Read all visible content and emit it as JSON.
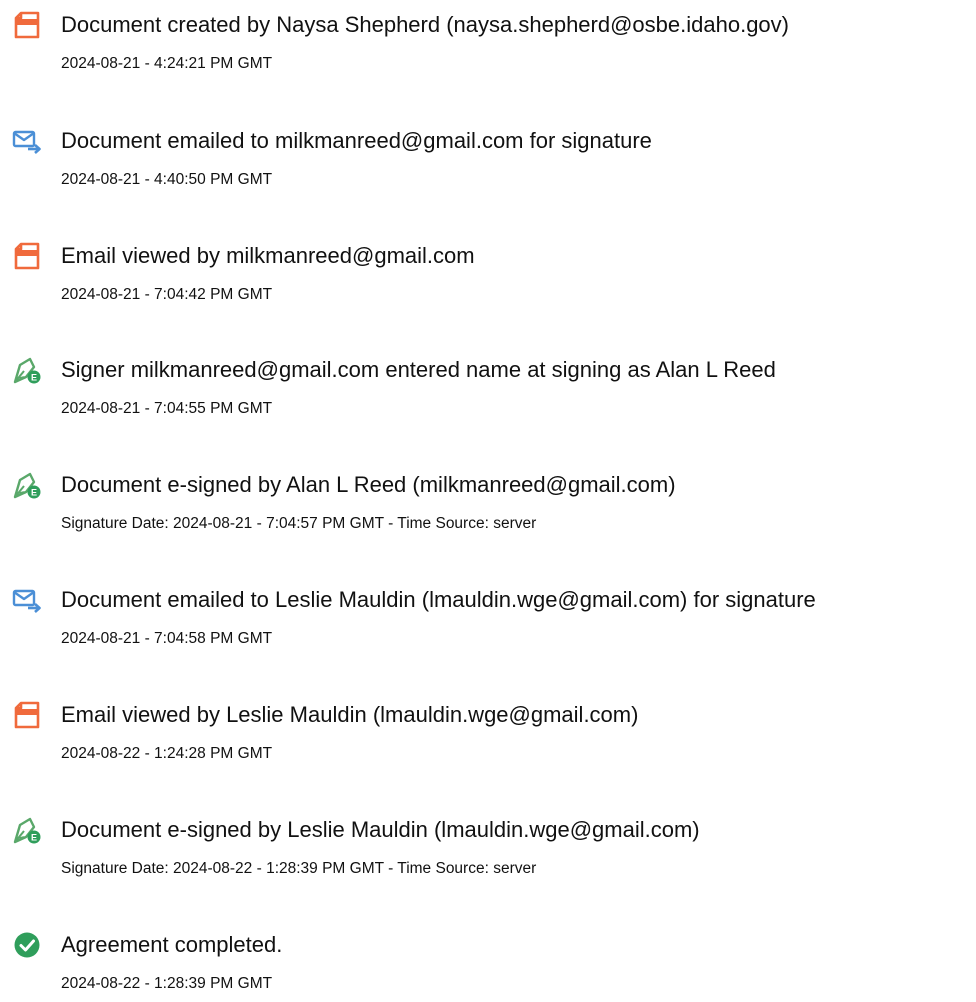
{
  "events": [
    {
      "icon": "document-icon",
      "title": "Document created by Naysa Shepherd (naysa.shepherd@osbe.idaho.gov)",
      "sub": "2024-08-21 - 4:24:21 PM GMT"
    },
    {
      "icon": "email-icon",
      "title": "Document emailed to milkmanreed@gmail.com for signature",
      "sub": "2024-08-21 - 4:40:50 PM GMT"
    },
    {
      "icon": "document-icon",
      "title": "Email viewed by milkmanreed@gmail.com",
      "sub": "2024-08-21 - 7:04:42 PM GMT"
    },
    {
      "icon": "signature-pen-icon",
      "title": "Signer milkmanreed@gmail.com entered name at signing as Alan L Reed",
      "sub": "2024-08-21 - 7:04:55 PM GMT"
    },
    {
      "icon": "signature-pen-icon",
      "title": "Document e-signed by Alan L Reed (milkmanreed@gmail.com)",
      "sub": "Signature Date: 2024-08-21 - 7:04:57 PM GMT - Time Source: server"
    },
    {
      "icon": "email-icon",
      "title": "Document emailed to Leslie Mauldin (lmauldin.wge@gmail.com) for signature",
      "sub": "2024-08-21 - 7:04:58 PM GMT"
    },
    {
      "icon": "document-icon",
      "title": "Email viewed by Leslie Mauldin (lmauldin.wge@gmail.com)",
      "sub": "2024-08-22 - 1:24:28 PM GMT"
    },
    {
      "icon": "signature-pen-icon",
      "title": "Document e-signed by Leslie Mauldin (lmauldin.wge@gmail.com)",
      "sub": "Signature Date: 2024-08-22 - 1:28:39 PM GMT - Time Source: server"
    },
    {
      "icon": "check-circle-icon",
      "title": "Agreement completed.",
      "sub": "2024-08-22 - 1:28:39 PM GMT"
    }
  ],
  "colors": {
    "document_icon": "#f06a3c",
    "email_icon": "#4b8fd6",
    "signature_icon": "#5aa86a",
    "check_icon": "#2f9e5b"
  }
}
